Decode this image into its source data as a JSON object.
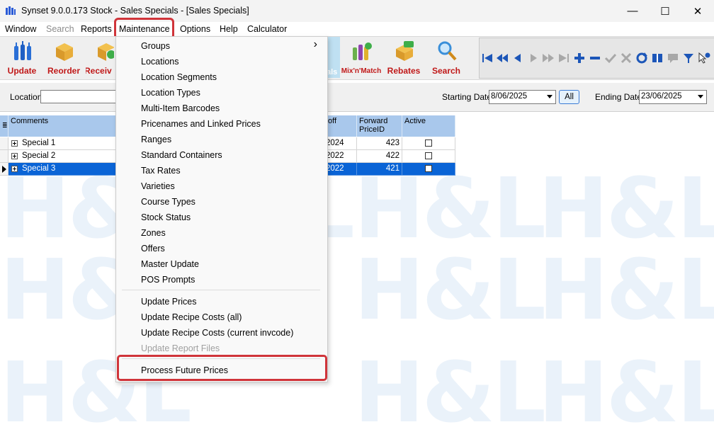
{
  "window": {
    "title": "Synset 9.0.0.173 Stock - Sales Specials - [Sales Specials]",
    "controls": [
      "—",
      "☐",
      "✕"
    ]
  },
  "menubar": {
    "items": [
      "Window",
      "Search",
      "Reports",
      "Maintenance",
      "Options",
      "Help",
      "Calculator"
    ]
  },
  "toolbar": {
    "buttons": [
      "Update",
      "Reorder",
      "Receiv",
      "als",
      "Mix'n'Match",
      "Rebates",
      "Search"
    ],
    "colors": {
      "label": "#c01818",
      "nav_blue": "#1c56b8",
      "nav_gray": "#a8a8a8"
    },
    "nav_icons": [
      "first-icon",
      "prev-page-icon",
      "prev-icon",
      "next-icon",
      "next-page-icon",
      "last-icon",
      "insert-icon",
      "delete-icon",
      "post-icon",
      "cancel-icon",
      "refresh-icon",
      "bookmark-icon",
      "comment-icon",
      "filter-icon",
      "help-cursor-icon"
    ]
  },
  "filters": {
    "location_label": "Location",
    "location_value": "",
    "starting_label": "Starting Date",
    "starting_value": "8/06/2025",
    "all_label": "All",
    "ending_label": "Ending Date",
    "ending_value": "23/06/2025"
  },
  "grid": {
    "headers": {
      "comments": "Comments",
      "off": "off",
      "forward_line1": "Forward",
      "forward_line2": "PriceID",
      "active": "Active"
    },
    "rows": [
      {
        "comment": "Special 1",
        "off": "2024",
        "forward": "423",
        "active": false
      },
      {
        "comment": "Special 2",
        "off": "2022",
        "forward": "422",
        "active": false
      },
      {
        "comment": "Special 3",
        "off": "2022",
        "forward": "421",
        "active": false
      }
    ],
    "selected_row": 2
  },
  "watermark": "H&L",
  "dropdown": {
    "items": [
      "Groups",
      "Locations",
      "Location Segments",
      "Location Types",
      "Multi-Item Barcodes",
      "Pricenames and Linked Prices",
      "Ranges",
      "Standard Containers",
      "Tax Rates",
      "Varieties",
      "Course Types",
      "Stock Status",
      "Zones",
      "Offers",
      "Master Update",
      "POS Prompts",
      "Update Prices",
      "Update Recipe Costs (all)",
      "Update Recipe Costs (current invcode)",
      "Update Report Files",
      "Process Future Prices"
    ],
    "submenu_arrow": "›",
    "highlight_color": "#d0343a"
  }
}
